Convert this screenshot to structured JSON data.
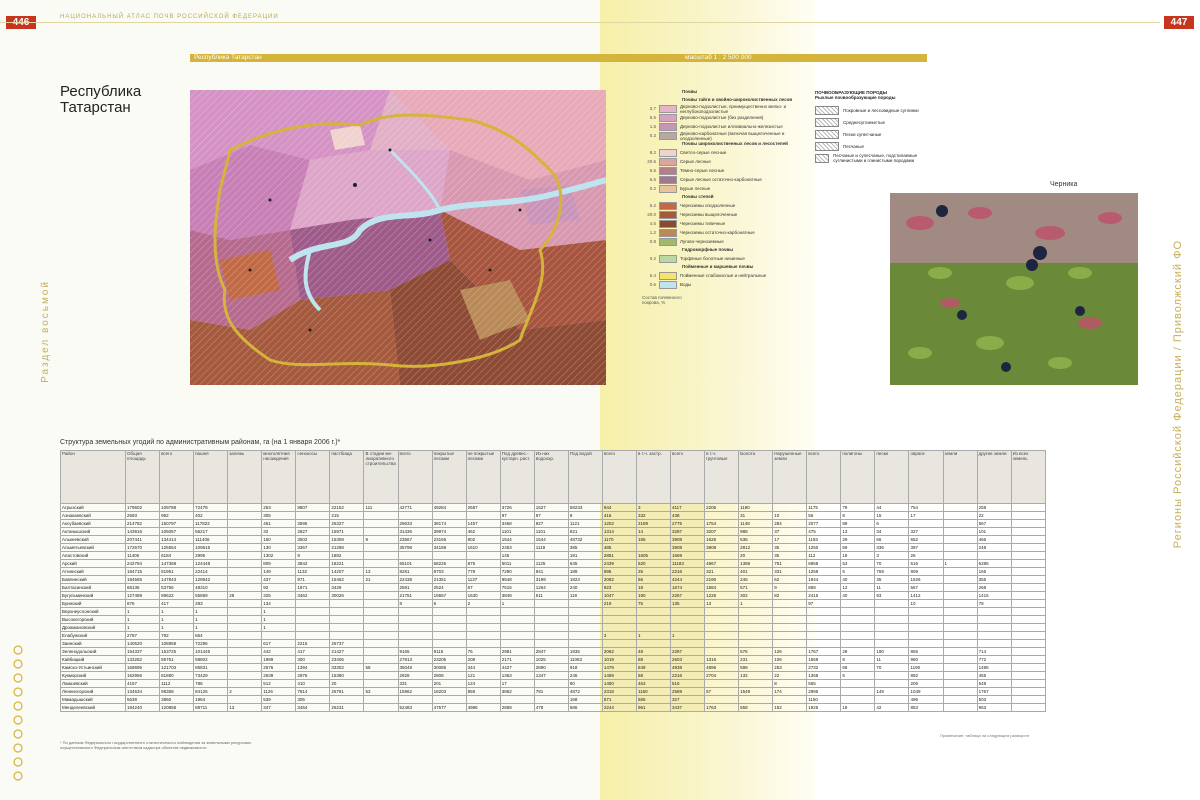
{
  "header": {
    "page_left": "446",
    "page_right": "447",
    "atlas_title": "НАЦИОНАЛЬНЫЙ АТЛАС ПОЧВ РОССИЙСКОЙ ФЕДЕРАЦИИ",
    "bar_left": "Республика Татарстан",
    "bar_right": "масштаб 1 : 2 500 000"
  },
  "title": {
    "line1": "Республика",
    "line2": "Татарстан"
  },
  "side_left": "Раздел восьмой",
  "side_right": "Регионы Российской Федерации / Приволжский ФО",
  "legend": {
    "title": "Почвы",
    "groups": [
      {
        "head": "Почвы тайги и хвойно-широколиственных лесов",
        "rows": [
          {
            "num": "3.7",
            "color": "#e6b3c9",
            "text": "Дерново-подзолистые, преимущественно мелко- и неглубокоподзолистые"
          },
          {
            "num": "6.5",
            "color": "#d9a0c4",
            "text": "Дерново-подзолистые (без разделения)"
          },
          {
            "num": "1.5",
            "color": "#c994b8",
            "text": "Дерново-подзолистые иллювиально-железистые"
          },
          {
            "num": "0.3",
            "color": "#b7a9a0",
            "text": "Дерново-карбонатные (включая выщелоченные и оподзоленные)"
          }
        ]
      },
      {
        "head": "Почвы широколиственных лесов и лесостепей",
        "rows": [
          {
            "num": "8.2",
            "color": "#f0d2cf",
            "text": "Светло-серые лесные"
          },
          {
            "num": "20.6",
            "color": "#d9a5a2",
            "text": "Серые лесные"
          },
          {
            "num": "6.6",
            "color": "#b67e8a",
            "text": "Темно-серые лесные"
          },
          {
            "num": "6.6",
            "color": "#a37692",
            "text": "Серые лесные остаточно-карбонатные"
          },
          {
            "num": "0.2",
            "color": "#e8c39c",
            "text": "Бурые лесные"
          }
        ]
      },
      {
        "head": "Почвы степей",
        "rows": [
          {
            "num": "5.2",
            "color": "#c26a46",
            "text": "Черноземы оподзоленные"
          },
          {
            "num": "20.0",
            "color": "#a65a3b",
            "text": "Черноземы выщелоченные"
          },
          {
            "num": "4.6",
            "color": "#8a4a2e",
            "text": "Черноземы типичные"
          },
          {
            "num": "1.2",
            "color": "#b98958",
            "text": "Черноземы остаточно-карбонатные"
          },
          {
            "num": "0.8",
            "color": "#9fb96d",
            "text": "Лугово-черноземные"
          }
        ]
      },
      {
        "head": "Гидроморфные почвы",
        "rows": [
          {
            "num": "0.2",
            "color": "#bcd7a0",
            "text": "Торфяные болотные низинные"
          }
        ]
      },
      {
        "head": "Пойменные и маршевые почвы",
        "rows": [
          {
            "num": "6.4",
            "color": "#f5e36a",
            "text": "Пойменные слабокислые и нейтральные"
          },
          {
            "num": "0.6",
            "color": "#bfe4ef",
            "text": "Воды"
          }
        ]
      }
    ],
    "note": "Состав почвенного покрова, %"
  },
  "legend2": {
    "title": "ПОЧВООБРАЗУЮЩИЕ ПОРОДЫ",
    "subtitle": "Рыхлые почвообразующие породы",
    "rows": [
      "Покровные и лессовидные суглинки",
      "Среднесуглинистые",
      "Пески супесчаные",
      "Песчаные",
      "Песчаные и супесчаные, подстилаемые суглинистыми и глинистыми породами"
    ]
  },
  "photo_caption": "Черника",
  "table": {
    "title": "Структура земельных угодий по административным районам, га (на 1 января 2006 г.)*",
    "headers": [
      "Район",
      "Общая площадь",
      "всего",
      "пашня",
      "залежь",
      "многолетние насаждения",
      "сенокосы",
      "пастбища",
      "В стадии ме-лиоративного строительства",
      "всего",
      "покрытые лесами",
      "не покрытые лесами",
      "Под древес.-кустарн. раст.",
      "Из них водоохр.",
      "Под водой",
      "всего",
      "в т.ч. застр.",
      "всего",
      "в т.ч. грунтовые",
      "Болота",
      "Нарушенные земли",
      "всего",
      "полигоны",
      "пески",
      "овраги",
      "земли",
      "другие земли",
      "Из всех земель"
    ],
    "rows": [
      [
        "Агрызский",
        "179602",
        "109788",
        "72478",
        "",
        "253",
        "8807",
        "22152",
        "111",
        "42771",
        "49284",
        "2587",
        "3726",
        "1527",
        "58233",
        "944",
        "3",
        "4117",
        "2206",
        "1190",
        "",
        "1175",
        "79",
        "44",
        "754",
        "",
        "258",
        ""
      ],
      [
        "Азнакаевский",
        "2593",
        "992",
        "402",
        "",
        "305",
        "",
        "215",
        "",
        "",
        "",
        "",
        "97",
        "97",
        "8",
        "416",
        "332",
        "438",
        "",
        "31",
        "10",
        "56",
        "8",
        "15",
        "17",
        "",
        "22",
        ""
      ],
      [
        "Аксубаевский",
        "214782",
        "150797",
        "117822",
        "",
        "461",
        "3596",
        "25327",
        "",
        "29633",
        "38174",
        "1457",
        "3468",
        "927",
        "1121",
        "1202",
        "2189",
        "2775",
        "1754",
        "1148",
        "284",
        "2077",
        "89",
        "6",
        "",
        "",
        "567",
        ""
      ],
      [
        "Актанышский",
        "143916",
        "105067",
        "56217",
        "",
        "32",
        "2827",
        "15971",
        "",
        "31436",
        "39974",
        "462",
        "1101",
        "1101",
        "821",
        "1314",
        "14",
        "3287",
        "3207",
        "988",
        "37",
        "475",
        "13",
        "34",
        "327",
        "",
        "101",
        ""
      ],
      [
        "Алькеевский",
        "207441",
        "134414",
        "111406",
        "",
        "150",
        "3502",
        "15308",
        "9",
        "23567",
        "23165",
        "802",
        "1544",
        "1544",
        "48732",
        "1170",
        "155",
        "3908",
        "1626",
        "536",
        "17",
        "1193",
        "29",
        "66",
        "652",
        "",
        "466",
        ""
      ],
      [
        "Альметьевский",
        "172670",
        "125554",
        "109615",
        "",
        "130",
        "3367",
        "21288",
        "",
        "35798",
        "34188",
        "1610",
        "2453",
        "1119",
        "385",
        "485",
        "",
        "3908",
        "3908",
        "2812",
        "35",
        "1250",
        "59",
        "336",
        "397",
        "",
        "248",
        ""
      ],
      [
        "Апастовский",
        "11406",
        "6184",
        "2995",
        "",
        "1302",
        "9",
        "1882",
        "",
        "",
        "",
        "",
        "145",
        "",
        "191",
        "2851",
        "1605",
        "1669",
        "",
        "20",
        "35",
        "112",
        "18",
        "3",
        "26",
        "",
        "",
        ""
      ],
      [
        "Арский",
        "242784",
        "147368",
        "124448",
        "",
        "809",
        "3842",
        "18221",
        "",
        "65101",
        "68226",
        "875",
        "5011",
        "1125",
        "645",
        "2439",
        "520",
        "11183",
        "4967",
        "1386",
        "751",
        "6958",
        "53",
        "70",
        "516",
        "1",
        "6285",
        ""
      ],
      [
        "Атнинский",
        "184715",
        "81951",
        "22414",
        "",
        "149",
        "1132",
        "14207",
        "13",
        "8281",
        "8703",
        "778",
        "7290",
        "941",
        "189",
        "895",
        "25",
        "2216",
        "321",
        "401",
        "331",
        "1259",
        "5",
        "769",
        "909",
        "",
        "165",
        ""
      ],
      [
        "Бавлинский",
        "184565",
        "147843",
        "128942",
        "",
        "437",
        "971",
        "15462",
        "21",
        "22438",
        "21351",
        "1137",
        "8548",
        "3199",
        "1824",
        "2082",
        "56",
        "4244",
        "2190",
        "246",
        "62",
        "1944",
        "40",
        "35",
        "1526",
        "",
        "355",
        ""
      ],
      [
        "Балтасинский",
        "68136",
        "53756",
        "48310",
        "",
        "92",
        "1871",
        "3429",
        "",
        "2591",
        "2524",
        "67",
        "7515",
        "1264",
        "240",
        "923",
        "18",
        "1674",
        "1584",
        "571",
        "9",
        "858",
        "12",
        "11",
        "567",
        "",
        "268",
        ""
      ],
      [
        "Бугульминский",
        "127489",
        "89622",
        "55869",
        "28",
        "325",
        "3462",
        "30026",
        "",
        "21751",
        "19557",
        "1630",
        "3848",
        "511",
        "119",
        "1047",
        "190",
        "2267",
        "1226",
        "302",
        "82",
        "2415",
        "40",
        "93",
        "1412",
        "",
        "1415",
        ""
      ],
      [
        "Буинский",
        "876",
        "417",
        "283",
        "",
        "134",
        "",
        "",
        "",
        "8",
        "6",
        "2",
        "1",
        "",
        "",
        "219",
        "75",
        "135",
        "13",
        "1",
        "",
        "97",
        "",
        "",
        "10",
        "",
        "78",
        ""
      ],
      [
        "Верхнеуслонский",
        "1",
        "1",
        "1",
        "",
        "1",
        "",
        "",
        "",
        "",
        "",
        "",
        "",
        "",
        "",
        "",
        "",
        "",
        "",
        "",
        "",
        "",
        "",
        "",
        "",
        "",
        "",
        ""
      ],
      [
        "Высокогорский",
        "1",
        "1",
        "1",
        "",
        "1",
        "",
        "",
        "",
        "",
        "",
        "",
        "",
        "",
        "",
        "",
        "",
        "",
        "",
        "",
        "",
        "",
        "",
        "",
        "",
        "",
        "",
        ""
      ],
      [
        "Дрожжановский",
        "1",
        "1",
        "1",
        "",
        "1",
        "",
        "",
        "",
        "",
        "",
        "",
        "",
        "",
        "",
        "",
        "",
        "",
        "",
        "",
        "",
        "",
        "",
        "",
        "",
        "",
        "",
        ""
      ],
      [
        "Елабужский",
        "2787",
        "792",
        "664",
        "",
        "",
        "",
        "",
        "",
        "",
        "",
        "",
        "",
        "",
        "",
        "3",
        "1",
        "1",
        "",
        "",
        "",
        "",
        "",
        "",
        "",
        "",
        "",
        ""
      ],
      [
        "Заинский",
        "140520",
        "108859",
        "72296",
        "",
        "617",
        "2215",
        "25737",
        "",
        "",
        "",
        "",
        "",
        "",
        "",
        "",
        "",
        "",
        "",
        "",
        "",
        "",
        "",
        "",
        "",
        "",
        "",
        ""
      ],
      [
        "Зеленодольский",
        "154337",
        "153725",
        "101445",
        "",
        "442",
        "417",
        "21427",
        "",
        "9165",
        "9115",
        "76",
        "2981",
        "2847",
        "1935",
        "2062",
        "48",
        "2287",
        "",
        "576",
        "126",
        "1767",
        "28",
        "190",
        "865",
        "",
        "714",
        ""
      ],
      [
        "Кайбицкий",
        "133282",
        "85751",
        "59802",
        "",
        "1989",
        "300",
        "23406",
        "",
        "27913",
        "23205",
        "208",
        "2171",
        "1025",
        "11083",
        "1019",
        "88",
        "2603",
        "1316",
        "231",
        "106",
        "1659",
        "8",
        "11",
        "960",
        "",
        "772",
        ""
      ],
      [
        "Камско-Устьинский",
        "168695",
        "121703",
        "85831",
        "",
        "2576",
        "1394",
        "33302",
        "58",
        "35049",
        "30085",
        "344",
        "4427",
        "2890",
        "918",
        "1479",
        "849",
        "4938",
        "4896",
        "598",
        "253",
        "2732",
        "68",
        "70",
        "1190",
        "",
        "1496",
        ""
      ],
      [
        "Кукморский",
        "162956",
        "81880",
        "73429",
        "",
        "2639",
        "2976",
        "15380",
        "",
        "2928",
        "2808",
        "121",
        "1363",
        "1347",
        "246",
        "1469",
        "58",
        "2216",
        "2704",
        "132",
        "22",
        "1368",
        "5",
        "",
        "892",
        "",
        "455",
        ""
      ],
      [
        "Лаишевский",
        "4157",
        "1112",
        "786",
        "",
        "512",
        "410",
        "20",
        "",
        "331",
        "201",
        "124",
        "17",
        "",
        "80",
        "1450",
        "463",
        "516",
        "",
        "",
        "8",
        "555",
        "",
        "",
        "206",
        "",
        "548",
        ""
      ],
      [
        "Лениногорский",
        "134534",
        "98358",
        "84125",
        "2",
        "1126",
        "7814",
        "25761",
        "53",
        "15962",
        "18203",
        "859",
        "3862",
        "781",
        "4872",
        "2318",
        "1160",
        "2589",
        "57",
        "1549",
        "174",
        "2995",
        "",
        "149",
        "1049",
        "",
        "1767",
        ""
      ],
      [
        "Мамадышский",
        "5638",
        "3860",
        "1964",
        "",
        "539",
        "305",
        "",
        "",
        "",
        "",
        "",
        "",
        "",
        "168",
        "871",
        "565",
        "327",
        "",
        "",
        "",
        "1150",
        "",
        "",
        "496",
        "",
        "503",
        ""
      ],
      [
        "Менделеевский",
        "184240",
        "120858",
        "88711",
        "13",
        "347",
        "3454",
        "26231",
        "",
        "52483",
        "47577",
        "4986",
        "2858",
        "478",
        "586",
        "2244",
        "961",
        "3437",
        "1763",
        "558",
        "152",
        "1925",
        "18",
        "42",
        "853",
        "",
        "963",
        ""
      ]
    ]
  },
  "footnote": "* По данным Федерального государственного статистического наблюдения за земельными ресурсами, осуществляемого Федеральным агентством кадастра объектов недвижимости",
  "foot_right": "Примечание: таблица на следующем развороте"
}
